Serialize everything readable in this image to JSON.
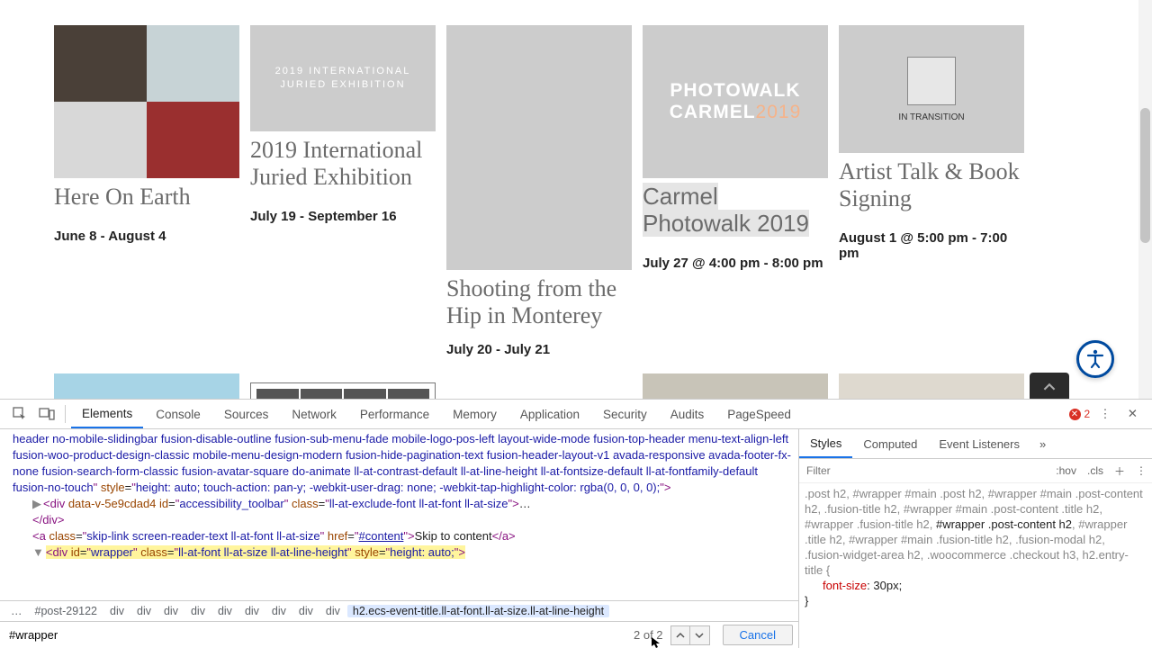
{
  "events": [
    {
      "title": "Here On Earth",
      "date": "June 8 - August 4",
      "highlight": false
    },
    {
      "title": "2019 International Juried Exhibition",
      "date": "July 19 - September 16",
      "highlight": false,
      "poster": "2019 INTERNATIONAL\nJURIED EXHIBITION"
    },
    {
      "title": "Shooting from the Hip in Monterey",
      "date": "July 20 - July 21",
      "highlight": false
    },
    {
      "title": "Carmel Photowalk 2019",
      "date": "July 27 @ 4:00 pm - 8:00 pm",
      "highlight": true,
      "poster": "PHOTOWALK\nCARMEL",
      "poster_year": "2019"
    },
    {
      "title": "Artist Talk & Book Signing",
      "date": "August 1 @ 5:00 pm - 7:00 pm",
      "highlight": false,
      "poster_caption": "IN TRANSITION"
    }
  ],
  "devtools": {
    "tabs": [
      "Elements",
      "Console",
      "Sources",
      "Network",
      "Performance",
      "Memory",
      "Application",
      "Security",
      "Audits",
      "PageSpeed"
    ],
    "active_tab": "Elements",
    "error_count": "2",
    "dom": {
      "line1": "header no-mobile-slidingbar fusion-disable-outline fusion-sub-menu-fade mobile-logo-pos-left layout-wide-mode fusion-top-header menu-text-align-left fusion-woo-product-design-classic mobile-menu-design-modern fusion-hide-pagination-text fusion-header-layout-v1 avada-responsive avada-footer-fx-none fusion-search-form-classic fusion-avatar-square do-animate ll-at-contrast-default ll-at-line-height ll-at-fontsize-default ll-at-fontfamily-default fusion-no-touch",
      "line1_style": "height: auto; touch-action: pan-y; -webkit-user-drag: none; -webkit-tap-highlight-color: rgba(0, 0, 0, 0);",
      "line2_attrs": {
        "data": "data-v-5e9cdad4",
        "id": "accessibility_toolbar",
        "class": "ll-at-exclude-font ll-at-font ll-at-size"
      },
      "line3": "</div>",
      "line4_class": "skip-link screen-reader-text ll-at-font ll-at-size",
      "line4_href": "#content",
      "line4_text": "Skip to content",
      "line5_id": "wrapper",
      "line5_class": "ll-at-font ll-at-size ll-at-line-height",
      "line5_style": "height: auto;"
    },
    "breadcrumb": [
      "…",
      "#post-29122",
      "div",
      "div",
      "div",
      "div",
      "div",
      "div",
      "div",
      "div",
      "div"
    ],
    "breadcrumb_sel": "h2.ecs-event-title.ll-at-font.ll-at-size.ll-at-line-height",
    "find": {
      "value": "#wrapper",
      "count": "2 of 2",
      "cancel": "Cancel"
    },
    "styles": {
      "tabs": [
        "Styles",
        "Computed",
        "Event Listeners"
      ],
      "active": "Styles",
      "filter_placeholder": "Filter",
      "hov": ":hov",
      "cls": ".cls",
      "selector_gray": ".post h2, #wrapper #main .post h2, #wrapper #main .post-content h2, .fusion-title h2, #wrapper #main .post-content .title h2, #wrapper .fusion-title h2, ",
      "selector_bold": "#wrapper .post-content h2",
      "selector_gray2": ", #wrapper .title h2, #wrapper #main .fusion-title h2, .fusion-modal h2, .fusion-widget-area h2, .woocommerce .checkout h3, h2.entry-title {",
      "prop": "font-size",
      "propval": "30px;",
      "close": "}"
    }
  }
}
